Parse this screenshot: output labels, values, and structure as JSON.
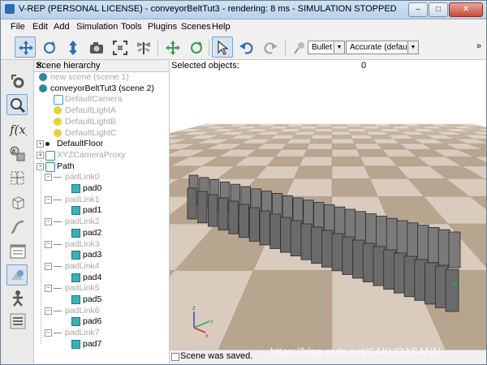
{
  "window": {
    "title": "V-REP (PERSONAL LICENSE) - conveyorBeltTut3 - rendering: 8 ms - SIMULATION STOPPED",
    "controls": {
      "minimize": "–",
      "maximize": "□",
      "close": "✕"
    }
  },
  "menubar": {
    "items": [
      "File",
      "Edit",
      "Add",
      "Simulation",
      "Tools",
      "Plugins",
      "Scenes",
      "Help"
    ]
  },
  "toolbar": {
    "engine": "Bullet",
    "accuracy": "Accurate (default)",
    "more": "»"
  },
  "hierarchy": {
    "header": "Scene hierarchy",
    "close": "✕",
    "items": [
      {
        "label": "new scene (scene 1)",
        "color": "#a8a8a8"
      },
      {
        "label": "conveyorBeltTut3 (scene 2)",
        "color": "#000000"
      },
      {
        "label": "DefaultCamera",
        "color": "#a8a8a8"
      },
      {
        "label": "DefaultLightA",
        "color": "#a8a8a8"
      },
      {
        "label": "DefaultLightB",
        "color": "#a8a8a8"
      },
      {
        "label": "DefaultLightC",
        "color": "#a8a8a8"
      },
      {
        "label": "DefaultFloor",
        "color": "#000000"
      },
      {
        "label": "XYZCameraProxy",
        "color": "#a8a8a8"
      },
      {
        "label": "Path",
        "color": "#000000"
      },
      {
        "label": "padLink0",
        "color": "#a8a8a8"
      },
      {
        "label": "pad0",
        "color": "#000000"
      },
      {
        "label": "padLink1",
        "color": "#a8a8a8"
      },
      {
        "label": "pad1",
        "color": "#000000"
      },
      {
        "label": "padLink2",
        "color": "#a8a8a8"
      },
      {
        "label": "pad2",
        "color": "#000000"
      },
      {
        "label": "padLink3",
        "color": "#a8a8a8"
      },
      {
        "label": "pad3",
        "color": "#000000"
      },
      {
        "label": "padLink4",
        "color": "#a8a8a8"
      },
      {
        "label": "pad4",
        "color": "#000000"
      },
      {
        "label": "padLink5",
        "color": "#a8a8a8"
      },
      {
        "label": "pad5",
        "color": "#000000"
      },
      {
        "label": "padLink6",
        "color": "#a8a8a8"
      },
      {
        "label": "pad6",
        "color": "#000000"
      },
      {
        "label": "padLink7",
        "color": "#a8a8a8"
      },
      {
        "label": "pad7",
        "color": "#000000"
      }
    ]
  },
  "viewport": {
    "selected_label": "Selected objects:",
    "selected_count": "0",
    "axes": {
      "x": "x",
      "y": "y",
      "z": "z"
    }
  },
  "status": {
    "message": "Scene was saved."
  },
  "watermark": "https://blog.csdn.net/SAKURASANN",
  "colors": {
    "floor_light": "#d9cbbd",
    "floor_dark": "#b8a590",
    "sky": "#ffffff",
    "pad": "#6a6a6a"
  }
}
